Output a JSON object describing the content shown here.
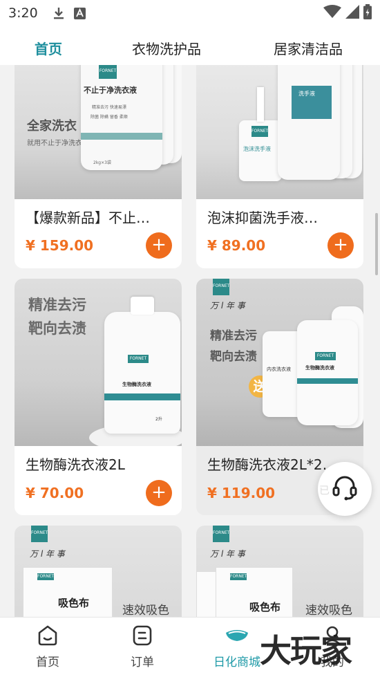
{
  "status_bar": {
    "time": "3:20"
  },
  "tabs": [
    {
      "label": "首页",
      "active": true
    },
    {
      "label": "衣物洗护品",
      "active": false
    },
    {
      "label": "居家清洁品",
      "active": false
    }
  ],
  "products": [
    {
      "title": "【爆款新品】不止…",
      "price": "¥ 159.00",
      "image_text": {
        "headline": "全家洗衣",
        "sub": "就用不止于净洗衣液",
        "pack_name": "不止于净洗衣液",
        "pack_features": "精准去污  快速易漂",
        "pack_features2": "除菌  除螨  留香  柔顺",
        "volume": "2kg×3袋",
        "brand": "FORNET"
      }
    },
    {
      "title": "泡沫抑菌洗手液…",
      "price": "¥ 89.00",
      "image_text": {
        "pump_label": "泡沫洗手液",
        "refill_label": "洗手液",
        "brand": "FORNET"
      }
    },
    {
      "title": "生物酶洗衣液2L",
      "price": "¥ 70.00",
      "image_text": {
        "headline1": "精准去污",
        "headline2": "靶向去渍",
        "bottle_label": "生物酶洗衣液",
        "volume": "2升",
        "brand": "FORNET"
      }
    },
    {
      "title": "生物酶洗衣液2L*2…",
      "price": "¥ 119.00",
      "image_text": {
        "script": "万 l 年 事",
        "headline1": "精准去污",
        "headline2": "靶向去渍",
        "gift": "送",
        "bottle_label": "生物酶洗衣液",
        "refill_label": "内衣洗衣液",
        "brand": "FORNET"
      }
    },
    {
      "title": "",
      "price": "",
      "image_text": {
        "script": "万 l 年 事",
        "box_label": "吸色布",
        "tagline": "速效吸色",
        "brand": "FORNET"
      }
    },
    {
      "title": "",
      "price": "",
      "image_text": {
        "script": "万 l 年 事",
        "box_label": "吸色布",
        "tagline": "速效吸色",
        "brand": "FORNET"
      }
    }
  ],
  "add_button_label": "+",
  "floating_button": {
    "icon": "headset-icon",
    "overlay_text": "已"
  },
  "bottom_nav": [
    {
      "label": "首页",
      "icon": "home-icon",
      "active": false
    },
    {
      "label": "订单",
      "icon": "order-icon",
      "active": false
    },
    {
      "label": "日化商城",
      "icon": "mall-icon",
      "active": true
    },
    {
      "label": "我的",
      "icon": "profile-icon",
      "active": false
    }
  ],
  "watermark": "大玩家",
  "colors": {
    "accent": "#1f8f9e",
    "price": "#f07022",
    "add_button": "#ef6c1d",
    "brand_teal": "#2c8a89"
  }
}
